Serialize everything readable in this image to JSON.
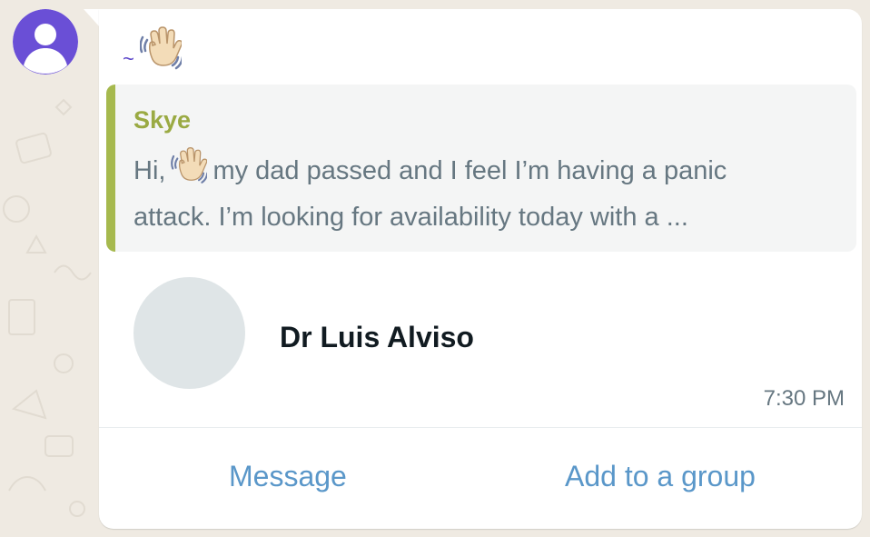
{
  "sender": {
    "name": "~",
    "emoji_icon": "waving-hand-icon"
  },
  "quote": {
    "author": "Skye",
    "line1_before": "Hi,",
    "line1_after": "my dad passed and I feel I’m having a panic",
    "line2": "attack. I’m looking for availability today with a ..."
  },
  "contact": {
    "name": "Dr Luis Alviso"
  },
  "message": {
    "time": "7:30 PM"
  },
  "actions": {
    "message_label": "Message",
    "add_group_label": "Add to a group"
  },
  "colors": {
    "chat_background": "#efeae2",
    "bubble": "#ffffff",
    "sender_name": "#5b45c9",
    "avatar": "#6a4fd6",
    "quote_bar": "#a6b94e",
    "quote_author": "#9aaa43",
    "link": "#5a97c9"
  }
}
